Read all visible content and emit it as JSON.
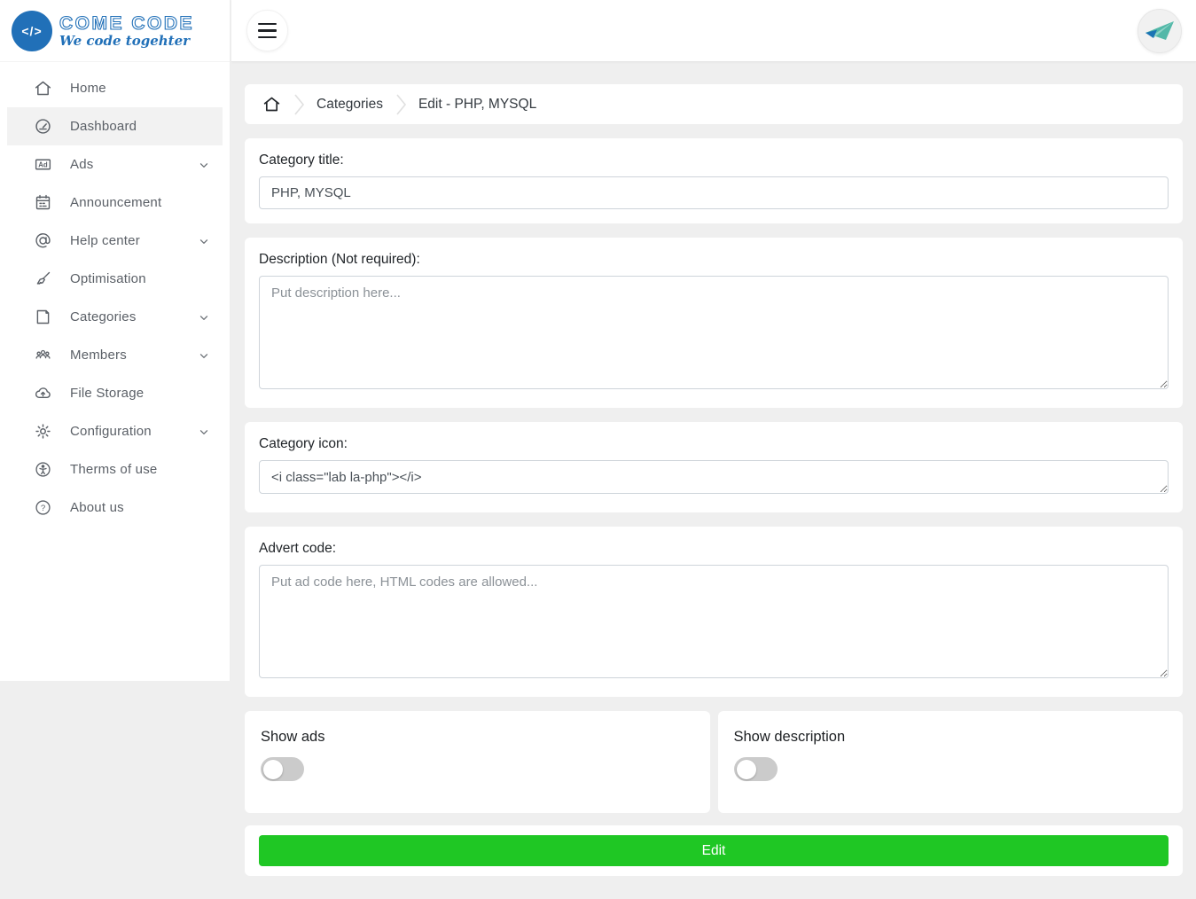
{
  "brand": {
    "title": "COME CODE",
    "tagline": "We code togehter",
    "logo_glyph": "</>"
  },
  "sidebar": {
    "items": [
      {
        "label": "Home",
        "icon": "home-icon",
        "active": false,
        "expandable": false
      },
      {
        "label": "Dashboard",
        "icon": "dashboard-icon",
        "active": true,
        "expandable": false
      },
      {
        "label": "Ads",
        "icon": "ads-icon",
        "active": false,
        "expandable": true
      },
      {
        "label": "Announcement",
        "icon": "announcement-icon",
        "active": false,
        "expandable": false
      },
      {
        "label": "Help center",
        "icon": "help-center-icon",
        "active": false,
        "expandable": true
      },
      {
        "label": "Optimisation",
        "icon": "optimisation-icon",
        "active": false,
        "expandable": false
      },
      {
        "label": "Categories",
        "icon": "categories-icon",
        "active": false,
        "expandable": true
      },
      {
        "label": "Members",
        "icon": "members-icon",
        "active": false,
        "expandable": true
      },
      {
        "label": "File Storage",
        "icon": "file-storage-icon",
        "active": false,
        "expandable": false
      },
      {
        "label": "Configuration",
        "icon": "configuration-icon",
        "active": false,
        "expandable": true
      },
      {
        "label": "Therms of use",
        "icon": "therms-of-use-icon",
        "active": false,
        "expandable": false
      },
      {
        "label": "About us",
        "icon": "about-us-icon",
        "active": false,
        "expandable": false
      }
    ]
  },
  "topbar": {
    "menu_icon": "hamburger-icon",
    "avatar_icon": "paper-plane-logo"
  },
  "breadcrumb": {
    "items": [
      {
        "label": "Categories"
      },
      {
        "label": "Edit - PHP, MYSQL"
      }
    ]
  },
  "form": {
    "category_title": {
      "label": "Category title:",
      "value": "PHP, MYSQL"
    },
    "description": {
      "label": "Description (Not required):",
      "placeholder": "Put description here..."
    },
    "category_icon": {
      "label": "Category icon:",
      "value": "<i class=\"lab la-php\"></i>"
    },
    "advert_code": {
      "label": "Advert code:",
      "placeholder": "Put ad code here, HTML codes are allowed..."
    },
    "show_ads": {
      "label": "Show ads",
      "state": "off"
    },
    "show_description": {
      "label": "Show description",
      "state": "off"
    },
    "submit_label": "Edit"
  },
  "colors": {
    "brand_blue": "#2170b8",
    "button_green": "#1fc724",
    "sidebar_text": "#5b6067",
    "active_item_bg": "#f2f2f2",
    "page_bg": "#efefef",
    "toggle_off": "#cbcbcb",
    "avatar_teal": "#53b8a8",
    "avatar_blue": "#1b74b4"
  }
}
